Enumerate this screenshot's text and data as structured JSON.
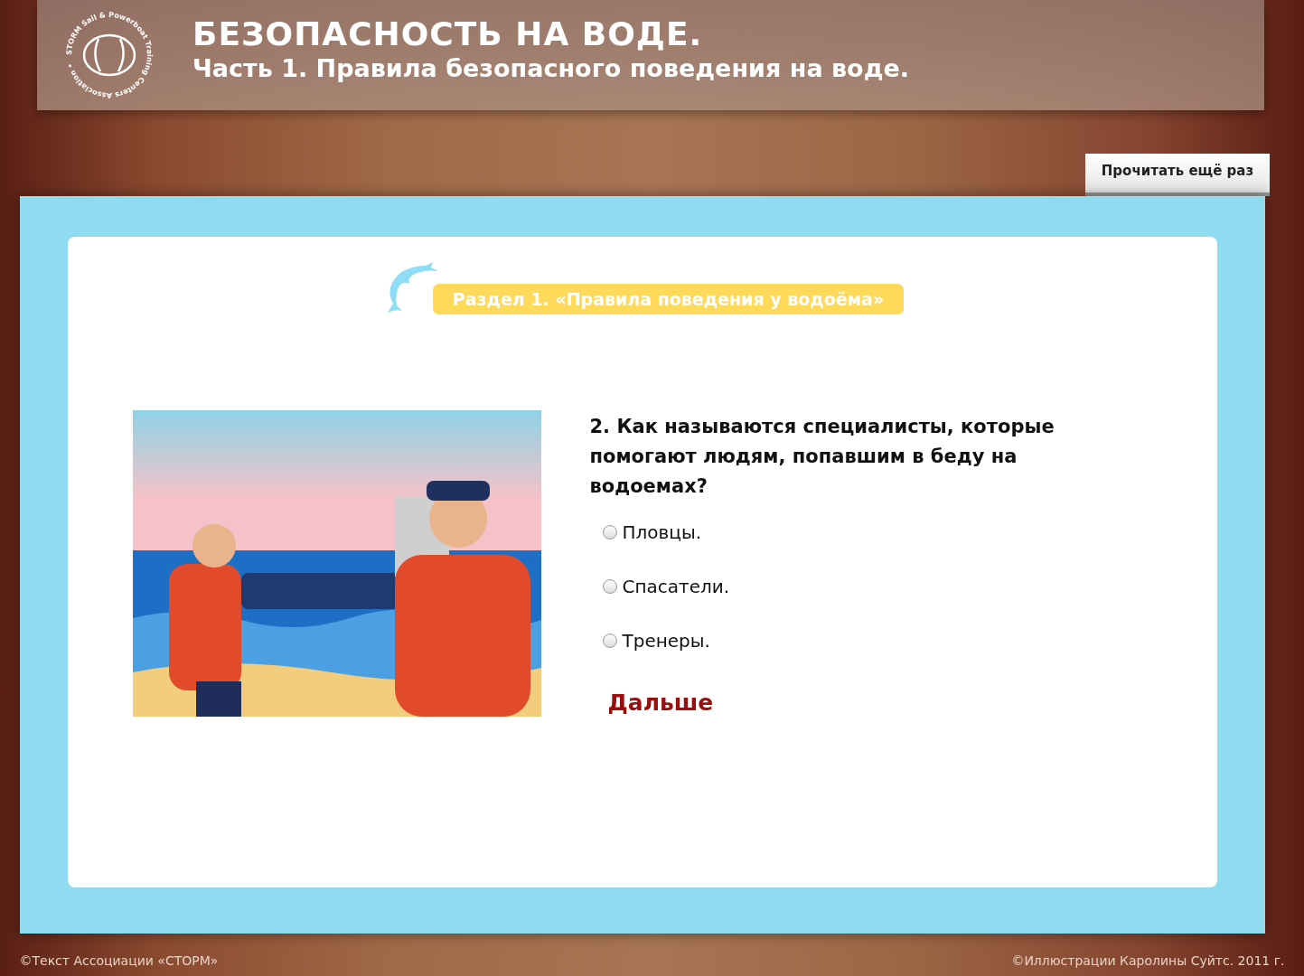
{
  "header": {
    "logo_text": "STORM Sail & Powerboat Training Centers Association •",
    "title": "БЕЗОПАСНОСТЬ НА ВОДЕ.",
    "subtitle": "Часть 1. Правила безопасного поведения на воде."
  },
  "reread_button": "Прочитать ещё раз",
  "section_label": "Раздел 1. «Правила поведения у водоёма»",
  "question": {
    "text": "2. Как называются специалисты, которые помогают людям, попавшим в беду на водоемах?",
    "options": [
      {
        "label": "Пловцы.",
        "selected": false
      },
      {
        "label": "Спасатели.",
        "selected": false
      },
      {
        "label": "Тренеры.",
        "selected": false
      }
    ]
  },
  "next_button": "Дальше",
  "footer": {
    "left": "©Текст Ассоциации «СТОРМ»",
    "right": "©Иллюстрации Каролины Суйтс. 2011 г."
  }
}
